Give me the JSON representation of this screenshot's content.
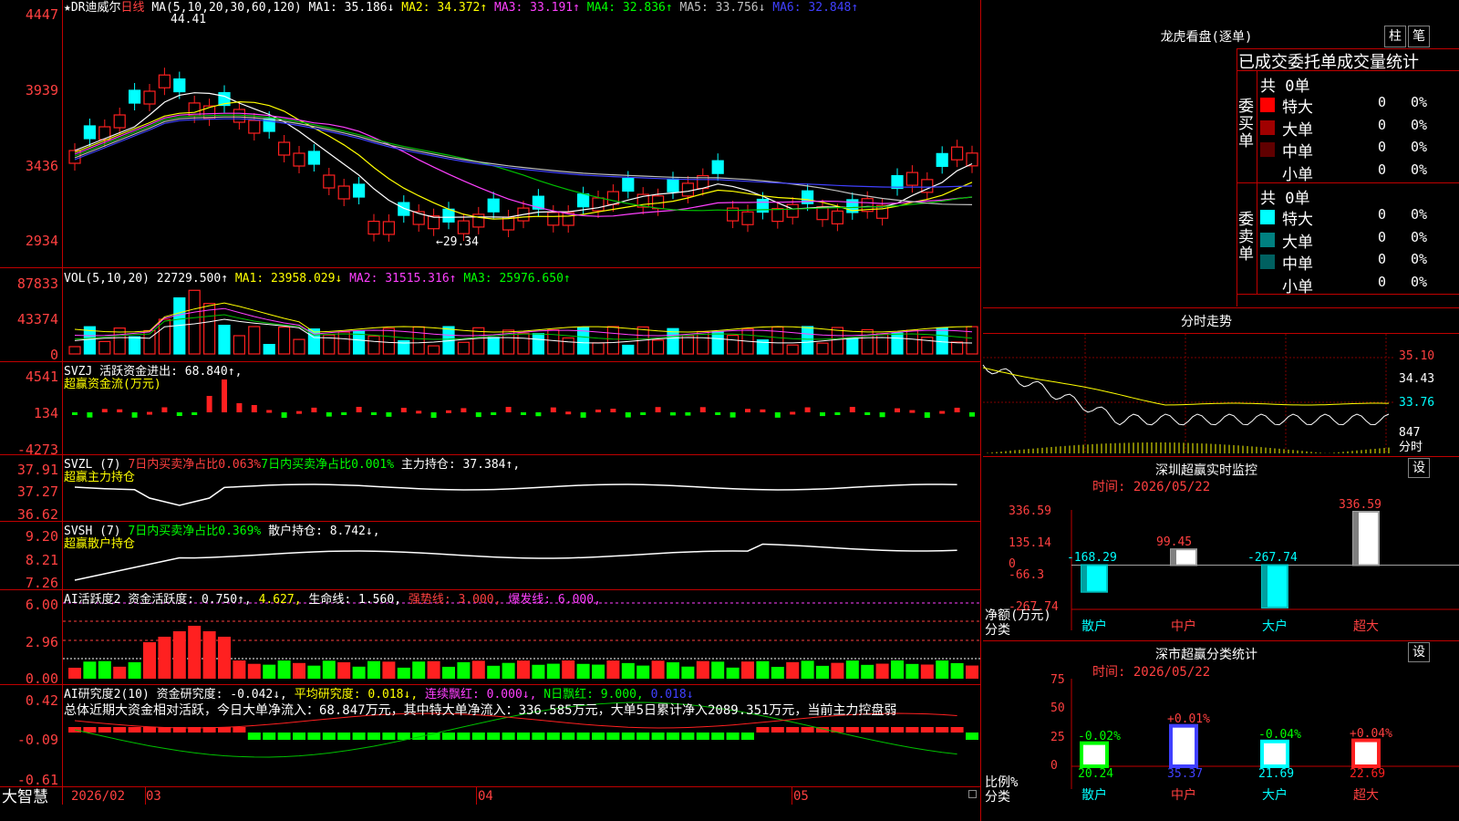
{
  "app_name": "大智慧",
  "colors": {
    "up": "#ff2020",
    "down": "#00ffff",
    "bg": "#000000",
    "grid": "#c00000",
    "ma1": "#ffffff",
    "ma2": "#ffff00",
    "ma3": "#ff40ff",
    "ma4": "#00c000",
    "ma5": "#c0c0c0",
    "ma6": "#4040ff"
  },
  "kline": {
    "header_star": "★",
    "stock_name": "DR迪威尔",
    "period": "日线",
    "ma_params": "MA(5,10,20,30,60,120)",
    "ma1": "MA1: 35.186↓",
    "ma2": "MA2: 34.372↑",
    "ma3": "MA3: 33.191↑",
    "ma4": "MA4: 32.836↑",
    "ma5": "MA5: 33.756↓",
    "ma6": "MA6: 32.848↑",
    "yticks": [
      "4447",
      "3939",
      "3436",
      "2934"
    ],
    "high_label": "44.41",
    "low_label": "←29.34",
    "dates": [
      "2026/02",
      "03",
      "04",
      "05"
    ]
  },
  "vol": {
    "header": "VOL(5,10,20)",
    "value": "22729.500↑",
    "ma1": "MA1: 23958.029↓",
    "ma2": "MA2: 31515.316↑",
    "ma3": "MA3: 25976.650↑",
    "yticks": [
      "87833",
      "43374",
      "0"
    ]
  },
  "svzj": {
    "header": "SVZJ  活跃资金进出: 68.840↑,",
    "subtitle": "超赢资金流(万元)",
    "yticks": [
      "4541",
      "134",
      "-4273"
    ]
  },
  "svzl": {
    "header_a": "SVZL (7)",
    "header_b": "7日内买卖净占比0.063%",
    "header_c": "7日内买卖净占比0.001%",
    "header_d": "主力持仓: 37.384↑,",
    "subtitle": "超赢主力持仓",
    "yticks": [
      "37.91",
      "37.27",
      "36.62"
    ]
  },
  "svsh": {
    "header_a": "SVSH (7)",
    "header_b": "7日内买卖净占比0.369%",
    "header_c": "散户持仓: 8.742↓,",
    "subtitle": "超赢散户持仓",
    "yticks": [
      "9.20",
      "8.21",
      "7.26"
    ]
  },
  "ai_act": {
    "header_a": "AI活跃度2 资金活跃度: 0.750↑,",
    "header_b": "4.627,",
    "header_c": "生命线: 1.560,",
    "header_d": "强势线: 3.000,",
    "header_e": "爆发线: 6.000,",
    "yticks": [
      "6.00",
      "2.96",
      "0.00"
    ]
  },
  "ai_res": {
    "header_a": "AI研究度2(10) 资金研究度: -0.042↓,",
    "header_b": "平均研究度: 0.018↓,",
    "header_c": "连续飘红: 0.000↓,",
    "header_d": "N日飘红: 9.000,",
    "header_e": "0.018↓",
    "summary": "总体近期大资金相对活跃，今日大单净流入：68.847万元，其中特大单净流入：336.585万元，大单5日累计净入2089.351万元，当前主力控盘弱",
    "yticks": [
      "0.42",
      "-0.09",
      "-0.61"
    ]
  },
  "right": {
    "lhb_title": "龙虎看盘(逐单)",
    "tab1": "柱",
    "tab2": "笔",
    "stat_title": "已成交委托单成交量统计",
    "buy_total": "共 0单",
    "buy_label": "委买单",
    "sell_total": "共 0单",
    "sell_label": "委卖单",
    "buy_rows": [
      {
        "name": "特大",
        "qty": "0",
        "pct": "0%",
        "color": "#ff0000"
      },
      {
        "name": "大单",
        "qty": "0",
        "pct": "0%",
        "color": "#a00000"
      },
      {
        "name": "中单",
        "qty": "0",
        "pct": "0%",
        "color": "#600000"
      },
      {
        "name": "小单",
        "qty": "0",
        "pct": "0%",
        "color": ""
      }
    ],
    "sell_rows": [
      {
        "name": "特大",
        "qty": "0",
        "pct": "0%",
        "color": "#00ffff"
      },
      {
        "name": "大单",
        "qty": "0",
        "pct": "0%",
        "color": "#008080"
      },
      {
        "name": "中单",
        "qty": "0",
        "pct": "0%",
        "color": "#006060"
      },
      {
        "name": "小单",
        "qty": "0",
        "pct": "0%",
        "color": ""
      }
    ],
    "fenshi_title": "分时走势",
    "fenshi_yticks": [
      "35.10",
      "34.43",
      "33.76"
    ],
    "fenshi_vol": "847",
    "fenshi_unit": "分时",
    "monitor_title": "深圳超赢实时监控",
    "monitor_setting": "设",
    "monitor_time": "时间: 2026/05/22",
    "monitor_yticks": [
      "336.59",
      "135.14",
      "0",
      "-66.3",
      "-267.74"
    ],
    "monitor_axis_label1": "净额(万元)",
    "monitor_axis_label2": "分类",
    "monitor_cats": [
      "散户",
      "中户",
      "大户",
      "超大"
    ],
    "monitor_values": [
      -168.29,
      99.45,
      -267.74,
      336.59
    ],
    "monitor_value_labels": [
      "-168.29",
      "99.45",
      "-267.74",
      "336.59"
    ],
    "class_title": "深市超赢分类统计",
    "class_setting": "设",
    "class_time": "时间: 2026/05/22",
    "class_yticks": [
      "75",
      "50",
      "25",
      "0"
    ],
    "class_axis_label1": "比例%",
    "class_axis_label2": "分类",
    "class_cats": [
      "散户",
      "中户",
      "大户",
      "超大"
    ],
    "class_values": [
      20.24,
      35.37,
      21.69,
      22.69
    ],
    "class_value_labels": [
      "20.24",
      "35.37",
      "21.69",
      "22.69"
    ],
    "class_change_labels": [
      "-0.02%",
      "+0.01%",
      "-0.04%",
      "+0.04%"
    ]
  }
}
